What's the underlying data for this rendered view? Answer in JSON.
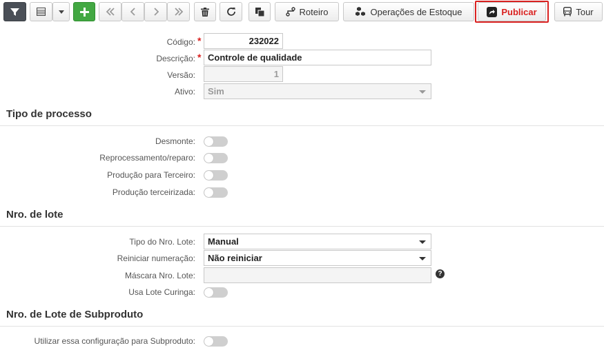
{
  "toolbar": {
    "roteiro_label": "Roteiro",
    "operacoes_label": "Operações de Estoque",
    "publicar_label": "Publicar",
    "tour_label": "Tour"
  },
  "form": {
    "codigo_label": "Código:",
    "codigo_value": "232022",
    "descricao_label": "Descrição:",
    "descricao_value": "Controle de qualidade",
    "versao_label": "Versão:",
    "versao_value": "1",
    "ativo_label": "Ativo:",
    "ativo_value": "Sim"
  },
  "tipo_processo": {
    "title": "Tipo de processo",
    "desmonte_label": "Desmonte:",
    "reprocessamento_label": "Reprocessamento/reparo:",
    "producao_terceiro_label": "Produção para Terceiro:",
    "producao_terceirizada_label": "Produção terceirizada:"
  },
  "nro_lote": {
    "title": "Nro. de lote",
    "tipo_label": "Tipo do Nro. Lote:",
    "tipo_value": "Manual",
    "reiniciar_label": "Reiniciar numeração:",
    "reiniciar_value": "Não reiniciar",
    "mascara_label": "Máscara Nro. Lote:",
    "mascara_value": "",
    "curinga_label": "Usa Lote Curinga:"
  },
  "subproduto": {
    "title": "Nro. de Lote de Subproduto",
    "utilizar_label": "Utilizar essa configuração para Subproduto:"
  },
  "icons": {
    "help": "?"
  },
  "colors": {
    "accent_red": "#d9201f",
    "add_green": "#43a843",
    "filter_dark": "#4a4f57"
  }
}
